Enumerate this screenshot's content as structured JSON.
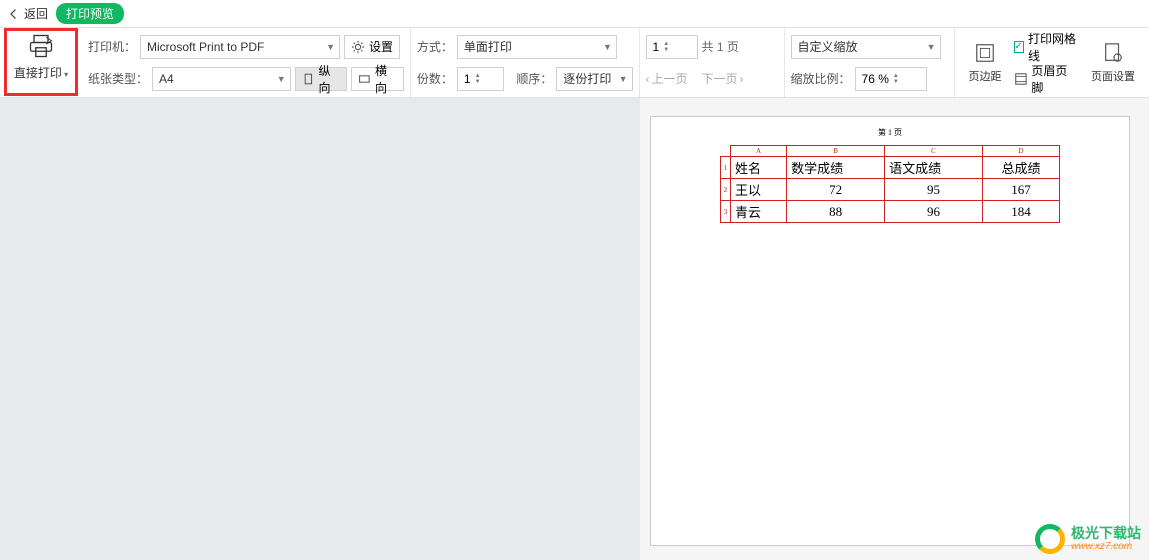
{
  "topbar": {
    "back": "返回",
    "title": "打印预览"
  },
  "direct_print": "直接打印",
  "printer": {
    "label": "打印机：",
    "value": "Microsoft Print to PDF"
  },
  "paper": {
    "label": "纸张类型：",
    "value": "A4"
  },
  "settings": "设置",
  "orient": {
    "portrait": "纵向",
    "landscape": "横向"
  },
  "mode": {
    "label": "方式：",
    "value": "单面打印"
  },
  "copies": {
    "label": "份数：",
    "value": "1"
  },
  "order": {
    "label": "顺序：",
    "value": "逐份打印"
  },
  "pager": {
    "current": "1",
    "total_prefix": "共 ",
    "total": "1",
    "total_suffix": " 页",
    "prev": "上一页",
    "next": "下一页"
  },
  "zoom": {
    "mode": "自定义缩放",
    "ratio_label": "缩放比例：",
    "ratio": "76 %"
  },
  "right": {
    "margins": "页边距",
    "gridlines": "打印网格线",
    "headerfooter": "页眉页脚",
    "pagesetup": "页面设置"
  },
  "preview": {
    "page_header": "第 1 页",
    "columns": [
      "A",
      "B",
      "C",
      "D"
    ],
    "headers": [
      "姓名",
      "数学成绩",
      "语文成绩",
      "总成绩"
    ],
    "rows": [
      {
        "n": "1"
      },
      {
        "n": "2",
        "cells": [
          "王以",
          "72",
          "95",
          "167"
        ]
      },
      {
        "n": "3",
        "cells": [
          "青云",
          "88",
          "96",
          "184"
        ]
      }
    ]
  },
  "watermark": {
    "cn": "极光下载站",
    "url": "www.xz7.com"
  }
}
